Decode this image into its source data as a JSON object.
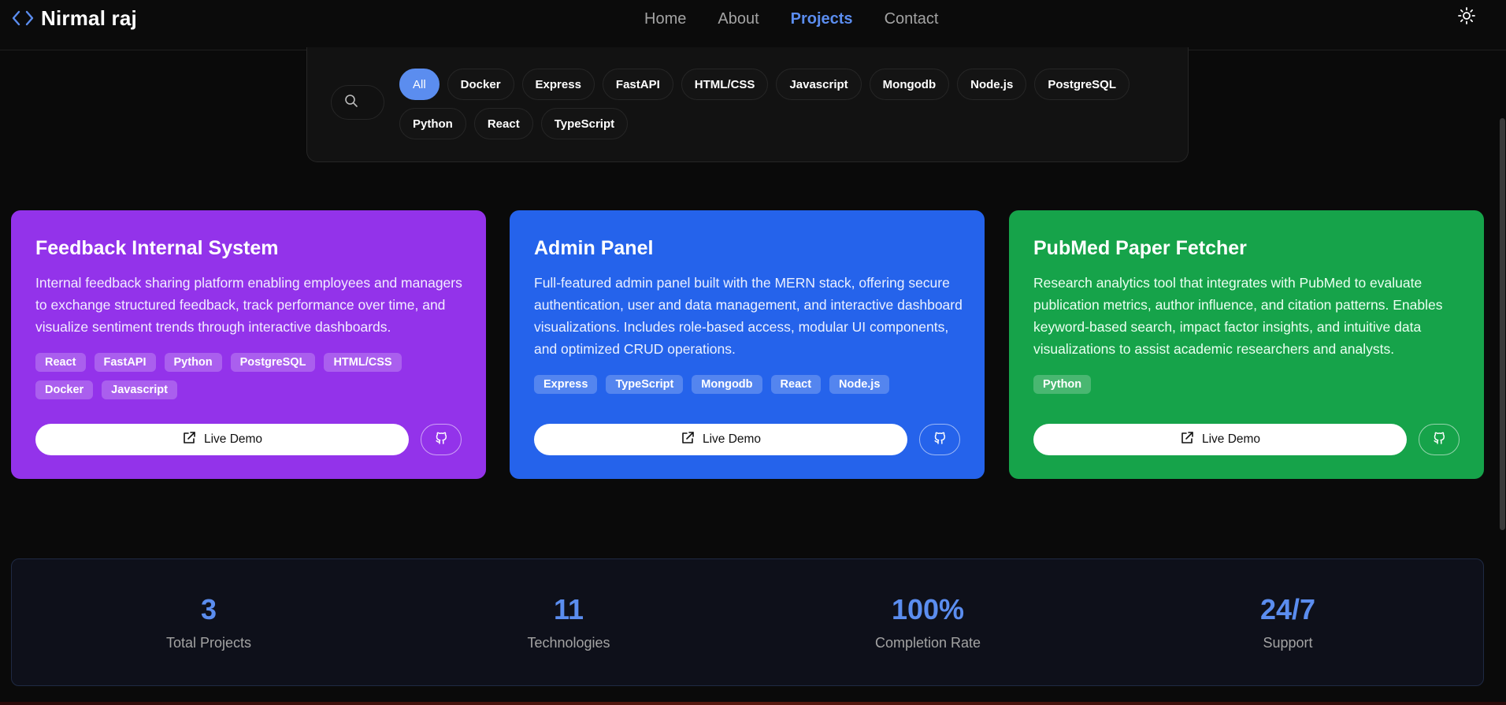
{
  "header": {
    "brand_name": "Nirmal raj",
    "brand_icon": "code-brackets-icon",
    "nav": [
      {
        "label": "Home",
        "active": false
      },
      {
        "label": "About",
        "active": false
      },
      {
        "label": "Projects",
        "active": true
      },
      {
        "label": "Contact",
        "active": false
      }
    ],
    "theme_icon": "sun-icon"
  },
  "filters": {
    "search_icon": "search-icon",
    "chips": [
      {
        "label": "All",
        "active": true
      },
      {
        "label": "Docker"
      },
      {
        "label": "Express"
      },
      {
        "label": "FastAPI"
      },
      {
        "label": "HTML/CSS"
      },
      {
        "label": "Javascript"
      },
      {
        "label": "Mongodb"
      },
      {
        "label": "Node.js"
      },
      {
        "label": "PostgreSQL"
      },
      {
        "label": "Python"
      },
      {
        "label": "React"
      },
      {
        "label": "TypeScript"
      }
    ]
  },
  "projects": [
    {
      "title": "Feedback Internal System",
      "description": "Internal feedback sharing platform enabling employees and managers to exchange structured feedback, track performance over time, and visualize sentiment trends through interactive dashboards.",
      "tags": [
        "React",
        "FastAPI",
        "Python",
        "PostgreSQL",
        "HTML/CSS",
        "Docker",
        "Javascript"
      ],
      "live_demo_label": "Live Demo",
      "color": "#9333ea"
    },
    {
      "title": "Admin Panel",
      "description": "Full-featured admin panel built with the MERN stack, offering secure authentication, user and data management, and interactive dashboard visualizations. Includes role-based access, modular UI components, and optimized CRUD operations.",
      "tags": [
        "Express",
        "TypeScript",
        "Mongodb",
        "React",
        "Node.js"
      ],
      "live_demo_label": "Live Demo",
      "color": "#2563eb"
    },
    {
      "title": "PubMed Paper Fetcher",
      "description": "Research analytics tool that integrates with PubMed to evaluate publication metrics, author influence, and citation patterns. Enables keyword-based search, impact factor insights, and intuitive data visualizations to assist academic researchers and analysts.",
      "tags": [
        "Python"
      ],
      "live_demo_label": "Live Demo",
      "color": "#16a34a"
    }
  ],
  "stats": [
    {
      "value": "3",
      "label": "Total Projects"
    },
    {
      "value": "11",
      "label": "Technologies"
    },
    {
      "value": "100%",
      "label": "Completion Rate"
    },
    {
      "value": "24/7",
      "label": "Support"
    }
  ],
  "colors": {
    "accent": "#5b8def",
    "background": "#0a0a0a"
  }
}
